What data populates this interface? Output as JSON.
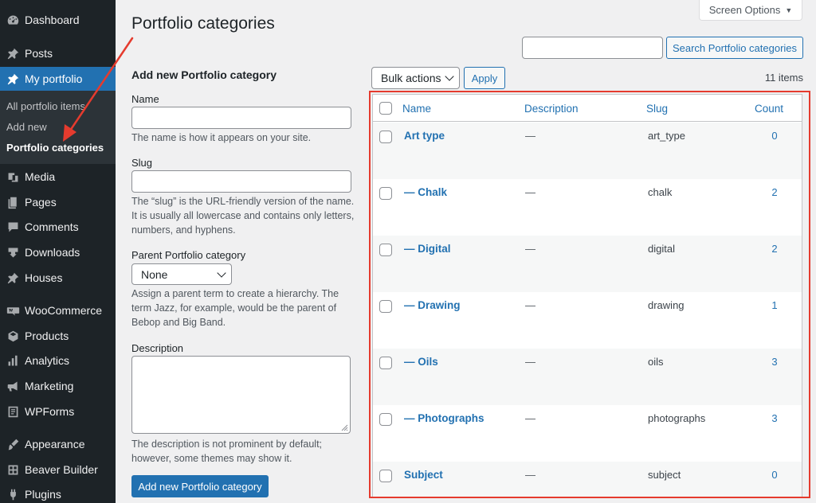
{
  "sidebar": {
    "items": [
      {
        "label": "Dashboard",
        "icon": "dashboard-icon"
      },
      {
        "label": "Posts",
        "icon": "pin-icon"
      },
      {
        "label": "My portfolio",
        "icon": "pin-icon"
      },
      {
        "label": "Media",
        "icon": "media-icon"
      },
      {
        "label": "Pages",
        "icon": "pages-icon"
      },
      {
        "label": "Comments",
        "icon": "comments-icon"
      },
      {
        "label": "Downloads",
        "icon": "downloads-icon"
      },
      {
        "label": "Houses",
        "icon": "pin-icon"
      },
      {
        "label": "WooCommerce",
        "icon": "woocommerce-icon"
      },
      {
        "label": "Products",
        "icon": "products-icon"
      },
      {
        "label": "Analytics",
        "icon": "analytics-icon"
      },
      {
        "label": "Marketing",
        "icon": "megaphone-icon"
      },
      {
        "label": "WPForms",
        "icon": "wpforms-icon"
      },
      {
        "label": "Appearance",
        "icon": "appearance-icon"
      },
      {
        "label": "Beaver Builder",
        "icon": "beaver-icon"
      },
      {
        "label": "Plugins",
        "icon": "plugins-icon"
      }
    ],
    "submenu": [
      "All portfolio items",
      "Add new",
      "Portfolio categories"
    ]
  },
  "header": {
    "title": "Portfolio categories",
    "screen_options": "Screen Options",
    "search_button": "Search Portfolio categories",
    "search_value": ""
  },
  "form": {
    "heading": "Add new Portfolio category",
    "name_label": "Name",
    "name_help": "The name is how it appears on your site.",
    "slug_label": "Slug",
    "slug_help": "The “slug” is the URL-friendly version of the name. It is usually all lowercase and contains only letters, numbers, and hyphens.",
    "parent_label": "Parent Portfolio category",
    "parent_value": "None",
    "parent_help": "Assign a parent term to create a hierarchy. The term Jazz, for example, would be the parent of Bebop and Big Band.",
    "description_label": "Description",
    "description_help": "The description is not prominent by default; however, some themes may show it.",
    "submit": "Add new Portfolio category"
  },
  "toolbar": {
    "bulk_actions": "Bulk actions",
    "apply": "Apply",
    "items_count": "11 items"
  },
  "table": {
    "columns": [
      "Name",
      "Description",
      "Slug",
      "Count"
    ],
    "rows": [
      {
        "name": "Art type",
        "description": "—",
        "slug": "art_type",
        "count": "0"
      },
      {
        "name": "— Chalk",
        "description": "—",
        "slug": "chalk",
        "count": "2"
      },
      {
        "name": "— Digital",
        "description": "—",
        "slug": "digital",
        "count": "2"
      },
      {
        "name": "— Drawing",
        "description": "—",
        "slug": "drawing",
        "count": "1"
      },
      {
        "name": "— Oils",
        "description": "—",
        "slug": "oils",
        "count": "3"
      },
      {
        "name": "— Photographs",
        "description": "—",
        "slug": "photographs",
        "count": "3"
      },
      {
        "name": "Subject",
        "description": "—",
        "slug": "subject",
        "count": "0"
      }
    ]
  },
  "colors": {
    "sidebar_bg": "#1d2327",
    "accent": "#2271b1",
    "annotation": "#e53b2e"
  }
}
